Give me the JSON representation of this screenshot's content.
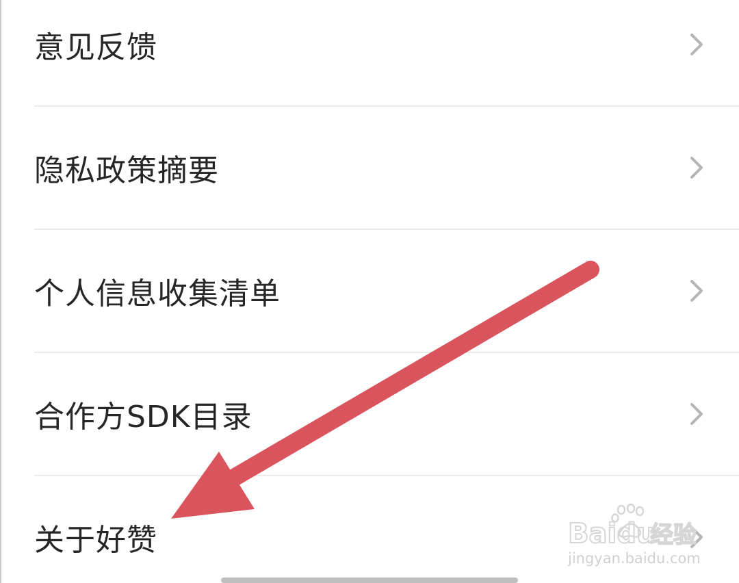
{
  "settings_menu": {
    "items": [
      {
        "label": "意见反馈"
      },
      {
        "label": "隐私政策摘要"
      },
      {
        "label": "个人信息收集清单"
      },
      {
        "label": "合作方SDK目录"
      },
      {
        "label": "关于好赞"
      }
    ]
  },
  "annotation": {
    "arrow_color": "#d9545c",
    "target": "关于好赞"
  },
  "watermark": {
    "brand": "Baidu",
    "brand_cn": "经验",
    "url": "jingyan.baidu.com",
    "icon": "paw-icon"
  },
  "colors": {
    "text": "#262626",
    "chevron": "#b5b5b5",
    "divider": "#ebebeb",
    "background": "#ffffff"
  }
}
